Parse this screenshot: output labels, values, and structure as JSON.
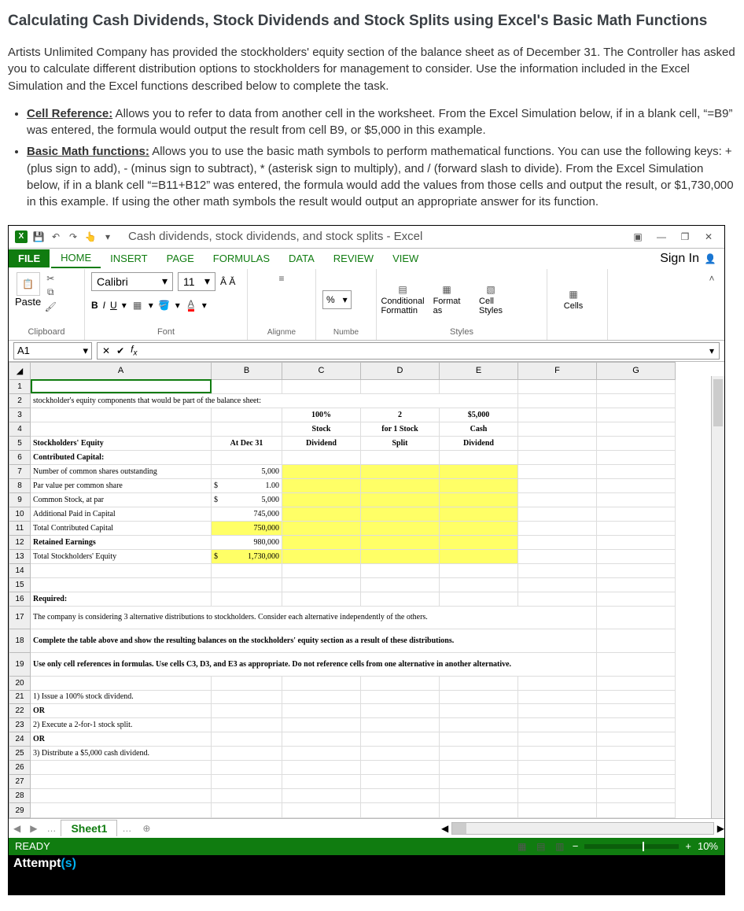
{
  "page": {
    "title": "Calculating Cash Dividends, Stock Dividends and Stock Splits using Excel's Basic Math Functions",
    "intro": "Artists Unlimited Company has provided the stockholders' equity section of the balance sheet as of December 31.  The Controller has asked you to calculate different distribution options to stockholders for management to consider.   Use the information included in the Excel Simulation and the Excel functions described below to complete the task.",
    "bullet1_label": "Cell Reference:",
    "bullet1_text": "  Allows you to refer to data from another cell in the worksheet.  From the Excel Simulation below, if in a blank cell, “=B9” was entered, the formula would output the result from cell B9, or $5,000 in this example.",
    "bullet2_label": "Basic Math functions:",
    "bullet2_text": "  Allows you to use the basic math symbols to perform mathematical functions.  You can use the following keys:  + (plus sign to add), - (minus sign to subtract), * (asterisk sign to multiply), and / (forward slash to divide).  From the Excel Simulation below, if in a blank cell “=B11+B12” was entered, the formula would add the values from those cells and output the result, or $1,730,000 in this example.  If using the other math symbols the result would output an appropriate answer for its function."
  },
  "excel": {
    "title": "Cash dividends, stock dividends, and stock splits - Excel",
    "signin": "Sign In",
    "tabs": {
      "file": "FILE",
      "home": "HOME",
      "insert": "INSERT",
      "page": "PAGE",
      "formulas": "FORMULAS",
      "data": "DATA",
      "review": "REVIEW",
      "view": "VIEW"
    },
    "ribbon": {
      "paste": "Paste",
      "clipboard": "Clipboard",
      "font_name": "Calibri",
      "font_size": "11",
      "font_glabel": "Font",
      "alignment": "Alignment",
      "number": "Number",
      "conditional": "Conditional Formatting",
      "formatas": "Format as",
      "cellstyles": "Cell Styles",
      "styles": "Styles",
      "cells": "Cells"
    },
    "namebox": "A1",
    "colhead": [
      "A",
      "B",
      "C",
      "D",
      "E",
      "F",
      "G"
    ],
    "rows": {
      "r2": "stockholder's equity components that would be part of the balance sheet:",
      "r3_c": "100%",
      "r3_d": "2",
      "r3_e": "$5,000",
      "r4_c": "Stock",
      "r4_d": "for 1 Stock",
      "r4_e": "Cash",
      "r5_a": "Stockholders' Equity",
      "r5_b": "At Dec 31",
      "r5_c": "Dividend",
      "r5_d": "Split",
      "r5_e": "Dividend",
      "r6_a": "Contributed Capital:",
      "r7_a": "Number of common shares outstanding",
      "r7_b": "5,000",
      "r8_a": "Par value per common share",
      "r8_b_cur": "$",
      "r8_b": "1.00",
      "r9_a": "Common Stock, at par",
      "r9_b_cur": "$",
      "r9_b": "5,000",
      "r10_a": "Additional Paid in Capital",
      "r10_b": "745,000",
      "r11_a": "Total Contributed Capital",
      "r11_b": "750,000",
      "r12_a": "Retained Earnings",
      "r12_b": "980,000",
      "r13_a": "Total Stockholders' Equity",
      "r13_b_cur": "$",
      "r13_b": "1,730,000",
      "r16": "Required:",
      "r17": "The company is considering 3 alternative distributions to stockholders.  Consider each alternative independently of the others.",
      "r18": "Complete the table above and show the resulting balances on the stockholders' equity section as a result of these distributions.",
      "r19": "Use only cell references in formulas.  Use cells C3, D3, and E3 as appropriate.  Do not reference cells from one alternative in another alternative.",
      "r21": "1) Issue a 100% stock dividend.",
      "r22": "OR",
      "r23": "2) Execute a 2-for-1 stock split.",
      "r24": "OR",
      "r25": "3) Distribute a $5,000 cash dividend."
    },
    "sheet_tab": "Sheet1",
    "status": "READY",
    "zoom": "10%",
    "attempts": "Attempt(s)"
  }
}
